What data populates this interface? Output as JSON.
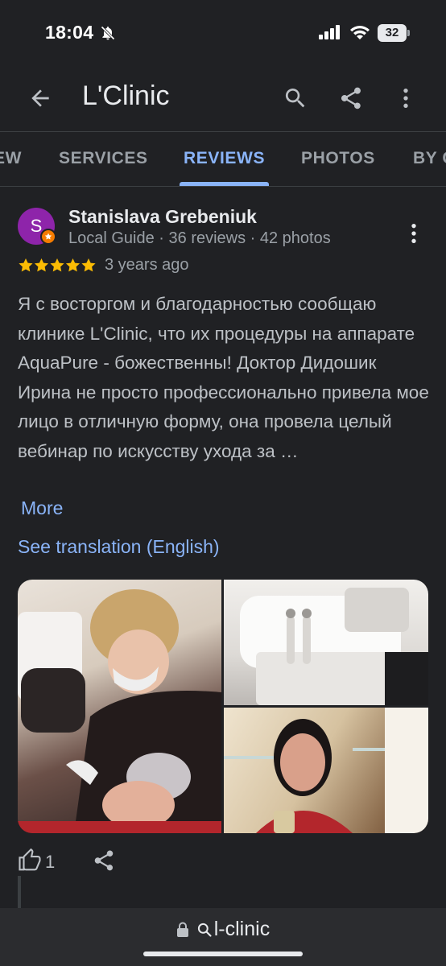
{
  "status_bar": {
    "time": "18:04",
    "battery": "32"
  },
  "app_bar": {
    "title": "L'Clinic"
  },
  "tabs": [
    {
      "label": "EW"
    },
    {
      "label": "SERVICES"
    },
    {
      "label": "REVIEWS",
      "active": true
    },
    {
      "label": "PHOTOS"
    },
    {
      "label": "BY C"
    }
  ],
  "review": {
    "avatar_letter": "S",
    "name": "Stanislava Grebeniuk",
    "meta": "Local Guide · 36 reviews · 42 photos",
    "rating": 5,
    "age": "3 years ago",
    "text": "Я с восторгом и благодарностью сообщаю клинике L'Clinic, что их процедуры на аппарате AquaPure - божественны! Доктор Дидошик Ирина не просто профессионально привела мое лицо в отличную форму, она провела целый вебинар по искусству ухода за …",
    "more_label": "More",
    "translation_label": "See translation (English)",
    "likes": "1"
  },
  "browser": {
    "url": "l-clinic"
  },
  "colors": {
    "accent": "#8ab4f8",
    "star": "#fbbc04",
    "background": "#202124"
  }
}
